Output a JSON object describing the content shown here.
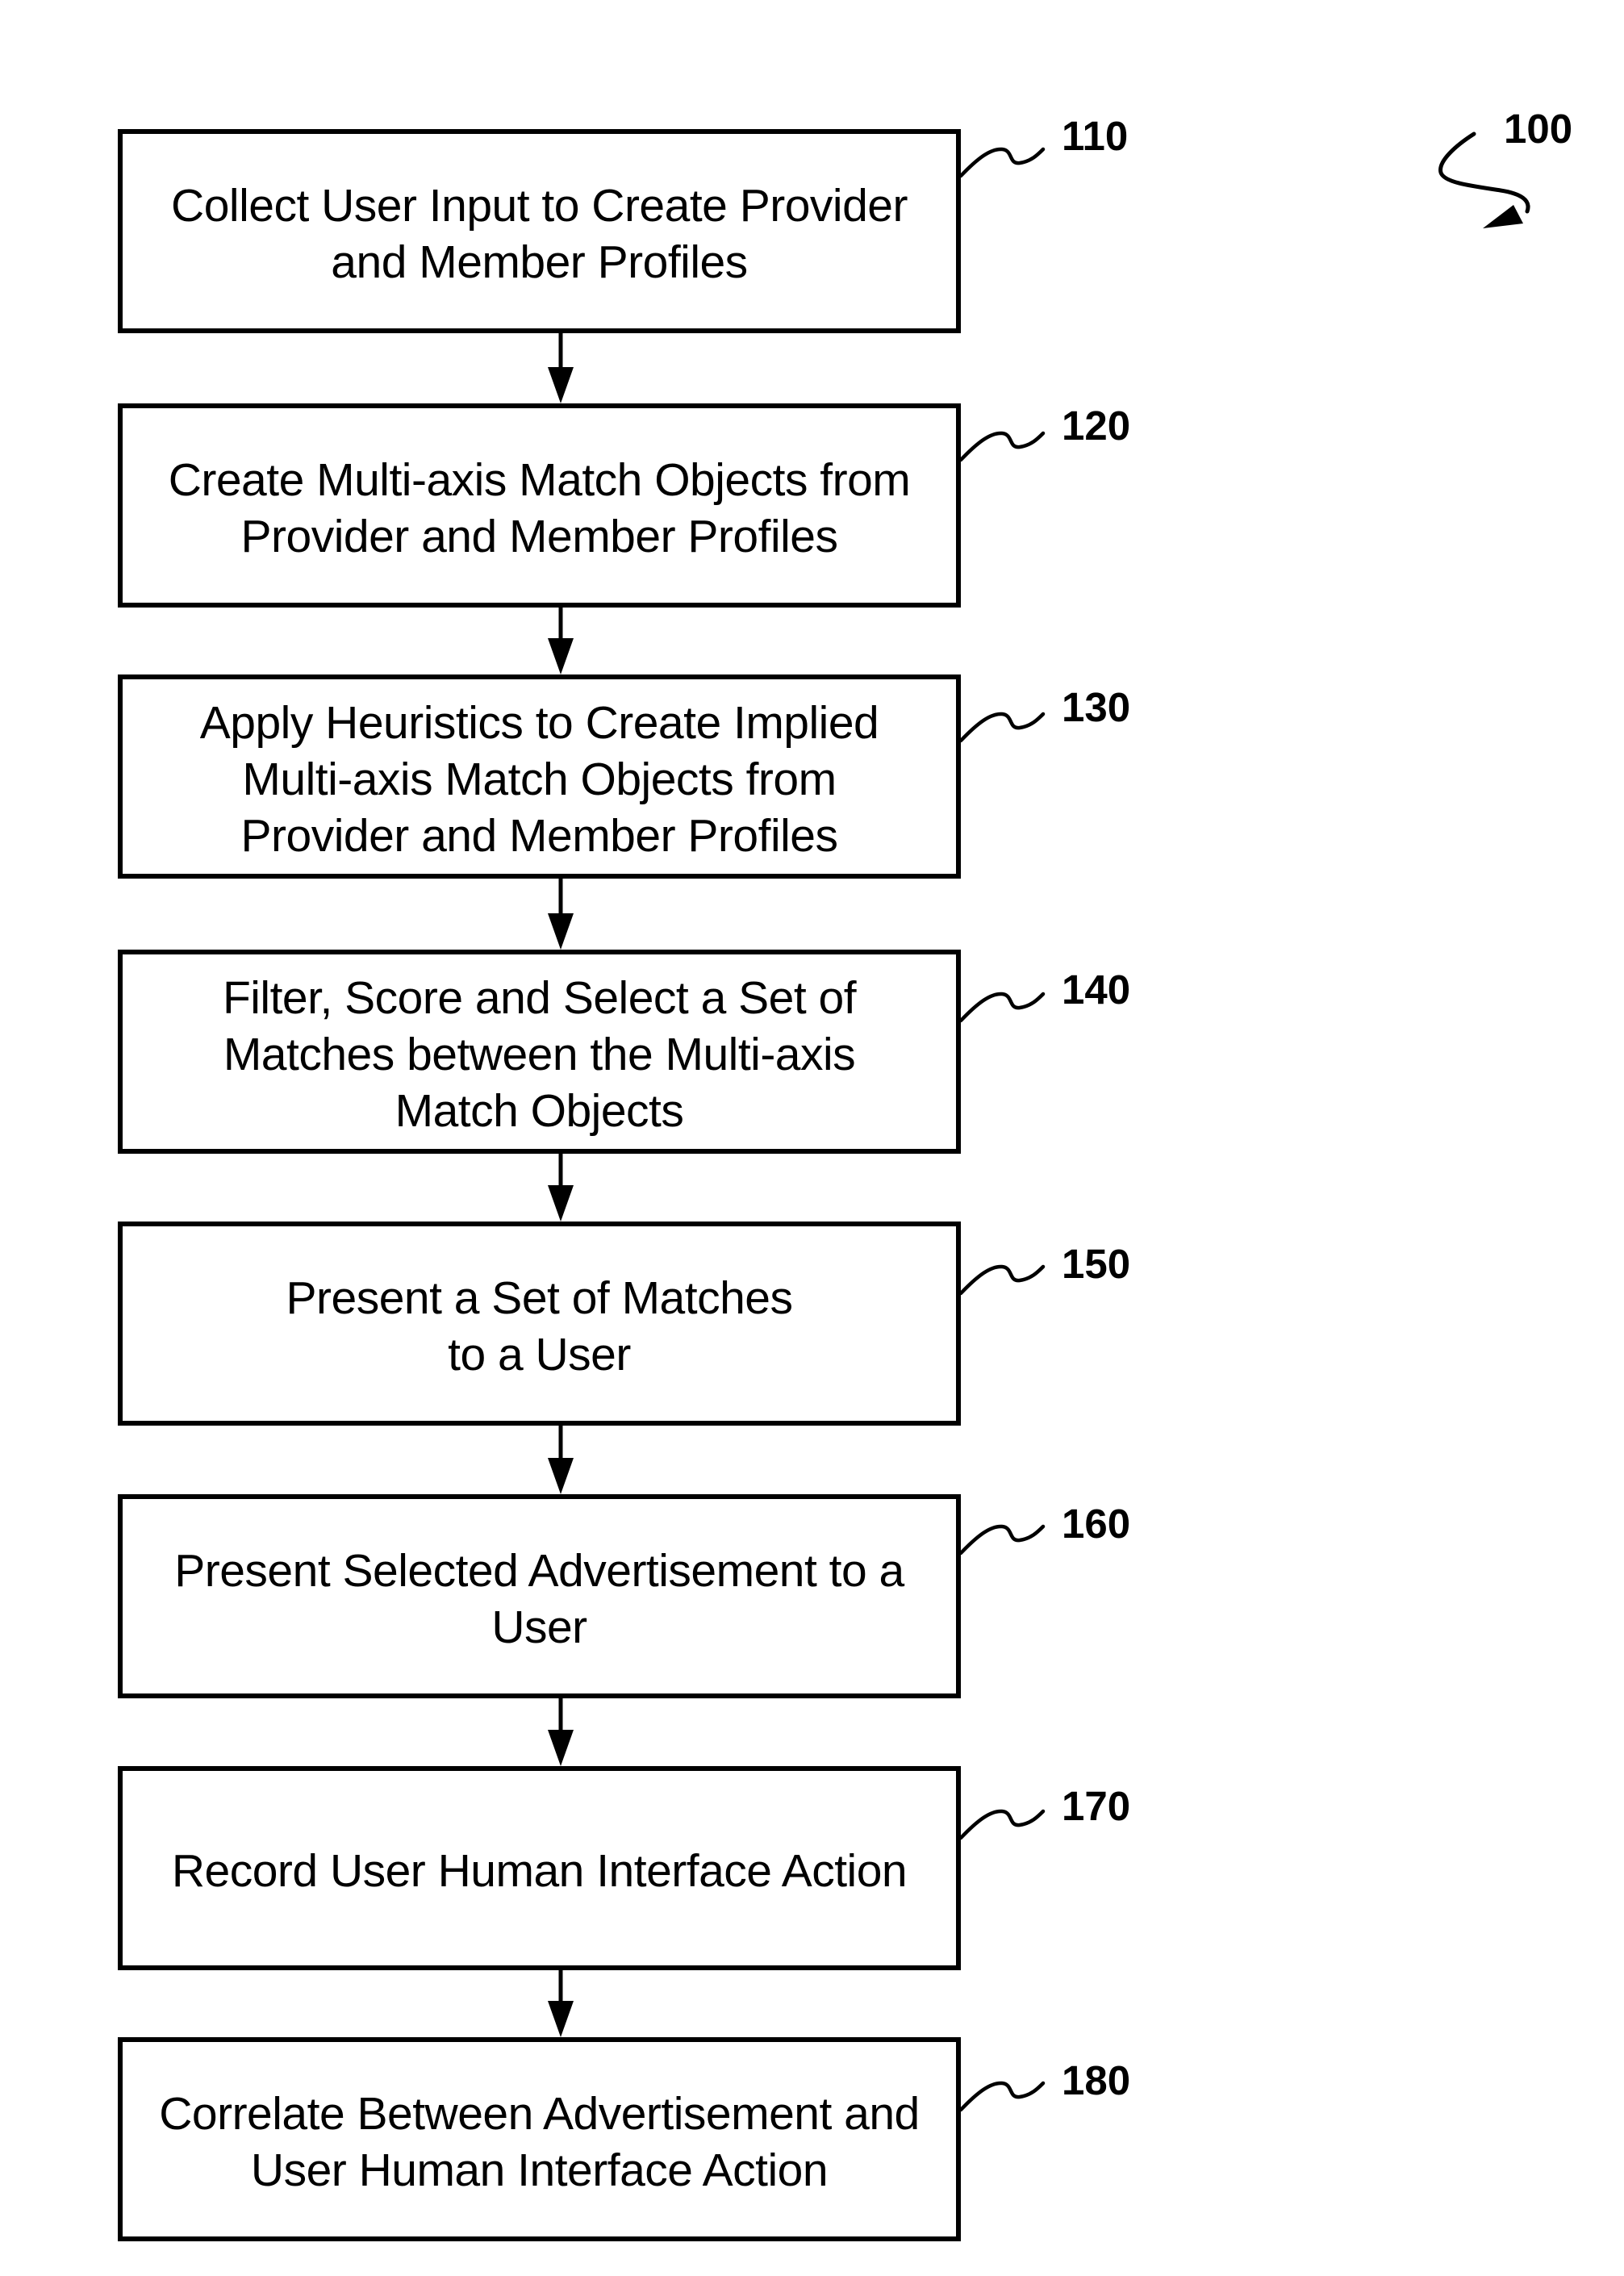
{
  "figure": {
    "reference_number": "100"
  },
  "steps": [
    {
      "id": "110",
      "lines": [
        "Collect User Input to Create Provider",
        "and Member Profiles"
      ]
    },
    {
      "id": "120",
      "lines": [
        "Create Multi-axis Match Objects from",
        "Provider and Member Profiles"
      ]
    },
    {
      "id": "130",
      "lines": [
        "Apply Heuristics to Create Implied",
        "Multi-axis Match Objects from",
        "Provider and Member Profiles"
      ]
    },
    {
      "id": "140",
      "lines": [
        "Filter, Score and Select a Set of",
        "Matches between the Multi-axis",
        "Match Objects"
      ]
    },
    {
      "id": "150",
      "lines": [
        "Present a Set of Matches",
        "to a User"
      ]
    },
    {
      "id": "160",
      "lines": [
        "Present Selected Advertisement to a",
        "User"
      ]
    },
    {
      "id": "170",
      "lines": [
        "Record User Human Interface Action"
      ]
    },
    {
      "id": "180",
      "lines": [
        "Correlate Between Advertisement and",
        "User Human Interface Action"
      ]
    }
  ],
  "colors": {
    "ink": "#000000",
    "background": "#ffffff"
  }
}
